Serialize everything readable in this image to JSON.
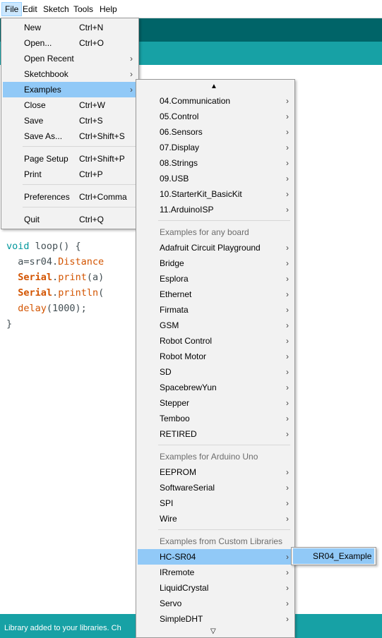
{
  "menubar": {
    "items": [
      "File",
      "Edit",
      "Sketch",
      "Tools",
      "Help"
    ]
  },
  "status_bar": {
    "text": "Library added to your libraries. Ch"
  },
  "code": {
    "line1_kw": "void",
    "line1_rest": " loop() {",
    "line2_a": "  a=sr04.",
    "line2_fn": "Distance",
    "line3_fn": "Serial",
    "line3_dot": ".",
    "line3_m": "print",
    "line3_rest": "(a)",
    "line4_fn": "Serial",
    "line4_dot": ".",
    "line4_m": "println",
    "line4_rest": "(",
    "line5_fn": "delay",
    "line5_rest": "(1000);",
    "line6": "}"
  },
  "file_menu": {
    "items": [
      {
        "label": "New",
        "shortcut": "Ctrl+N"
      },
      {
        "label": "Open...",
        "shortcut": "Ctrl+O"
      },
      {
        "label": "Open Recent",
        "submenu": true
      },
      {
        "label": "Sketchbook",
        "submenu": true
      },
      {
        "label": "Examples",
        "submenu": true,
        "highlighted": true
      },
      {
        "label": "Close",
        "shortcut": "Ctrl+W"
      },
      {
        "label": "Save",
        "shortcut": "Ctrl+S"
      },
      {
        "label": "Save As...",
        "shortcut": "Ctrl+Shift+S"
      },
      {
        "label": "Page Setup",
        "shortcut": "Ctrl+Shift+P"
      },
      {
        "label": "Print",
        "shortcut": "Ctrl+P"
      },
      {
        "label": "Preferences",
        "shortcut": "Ctrl+Comma"
      },
      {
        "label": "Quit",
        "shortcut": "Ctrl+Q"
      }
    ]
  },
  "examples_menu": {
    "builtin": [
      "04.Communication",
      "05.Control",
      "06.Sensors",
      "07.Display",
      "08.Strings",
      "09.USB",
      "10.StarterKit_BasicKit",
      "11.ArduinoISP"
    ],
    "any_board_header": "Examples for any board",
    "any_board": [
      "Adafruit Circuit Playground",
      "Bridge",
      "Esplora",
      "Ethernet",
      "Firmata",
      "GSM",
      "Robot Control",
      "Robot Motor",
      "SD",
      "SpacebrewYun",
      "Stepper",
      "Temboo",
      "RETIRED"
    ],
    "uno_header": "Examples for Arduino Uno",
    "uno": [
      "EEPROM",
      "SoftwareSerial",
      "SPI",
      "Wire"
    ],
    "custom_header": "Examples from Custom Libraries",
    "custom": [
      "HC-SR04",
      "IRremote",
      "LiquidCrystal",
      "Servo",
      "SimpleDHT"
    ],
    "highlighted": "HC-SR04"
  },
  "hcsr04_menu": {
    "items": [
      "SR04_Example"
    ]
  },
  "icons": {
    "submenu_arrow": "›",
    "scroll_up": "▲",
    "scroll_down": "▽"
  },
  "colors": {
    "toolbar": "#006468",
    "tabbar": "#17a1a5",
    "highlight": "#91c9f7"
  }
}
